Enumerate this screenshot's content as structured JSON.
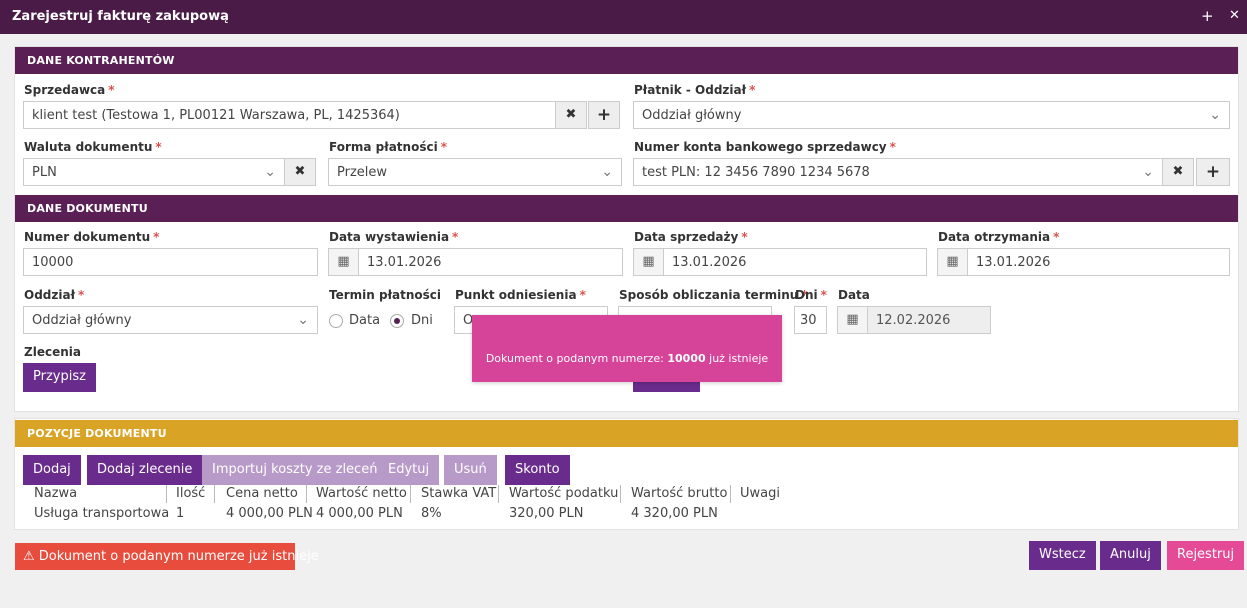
{
  "window": {
    "title": "Zarejestruj fakturę zakupową",
    "add_icon": "+",
    "close_icon": "✕"
  },
  "contractors": {
    "header": "DANE KONTRAHENTÓW",
    "seller_label": "Sprzedawca",
    "seller_value": "klient test (Testowa 1, PL00121 Warszawa, PL, 1425364)",
    "payer_label": "Płatnik - Oddział",
    "payer_value": "Oddział główny",
    "currency_label": "Waluta dokumentu",
    "currency_value": "PLN",
    "payment_form_label": "Forma płatności",
    "payment_form_value": "Przelew",
    "bank_account_label": "Numer konta bankowego sprzedawcy",
    "bank_account_value": "test PLN: 12 3456 7890 1234 5678"
  },
  "document": {
    "header": "DANE DOKUMENTU",
    "number_label": "Numer dokumentu",
    "number_value": "10000",
    "issue_date_label": "Data wystawienia",
    "issue_date_value": "13.01.2026",
    "sale_date_label": "Data sprzedaży",
    "sale_date_value": "13.01.2026",
    "receipt_date_label": "Data otrzymania",
    "receipt_date_value": "13.01.2026",
    "branch_label": "Oddział",
    "branch_value": "Oddział główny",
    "term_label": "Termin płatności",
    "term_option_date": "Data",
    "term_option_days": "Dni",
    "reference_label": "Punkt odniesienia",
    "reference_value": "O",
    "method_label": "Sposób obliczania terminu",
    "days_label": "Dni",
    "days_value": "30",
    "date_label": "Data",
    "date_value": "12.02.2026",
    "orders_label": "Zlecenia",
    "assign_button": "Przypisz"
  },
  "toast": {
    "prefix": "Dokument o podanym numerze: ",
    "number": "10000",
    "suffix": " już istnieje"
  },
  "positions": {
    "header": "POZYCJE DOKUMENTU",
    "buttons": {
      "add": "Dodaj",
      "add_order": "Dodaj zlecenie",
      "import_costs": "Importuj koszty ze zleceń",
      "edit": "Edytuj",
      "delete": "Usuń",
      "discount": "Skonto"
    },
    "columns": [
      "Nazwa",
      "Ilość",
      "Cena netto",
      "Wartość netto",
      "Stawka VAT",
      "Wartość podatku",
      "Wartość brutto",
      "Uwagi"
    ],
    "rows": [
      [
        "Usługa transportowa",
        "1",
        "4 000,00 PLN",
        "4 000,00 PLN",
        "8%",
        "320,00 PLN",
        "4 320,00 PLN",
        ""
      ]
    ]
  },
  "footer": {
    "error_text": "Dokument o podanym numerze już istnieje",
    "back_button": "Wstecz",
    "cancel_button": "Anuluj",
    "register_button": "Rejestruj"
  },
  "colors": {
    "titlebar": "#4a1b47",
    "section_header": "#5a1f55",
    "positions_header": "#d9a425",
    "primary_button": "#6a2c8c",
    "register_button": "#e44a95",
    "error": "#e74c3c",
    "toast": "#d6449a"
  }
}
